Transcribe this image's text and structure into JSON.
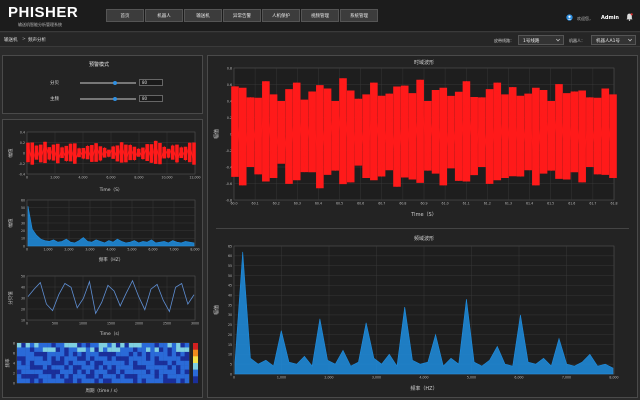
{
  "app": {
    "logo": "PHISHER",
    "subtitle": "输送机智能分析管理系统"
  },
  "nav": [
    "首页",
    "机器人",
    "输送机",
    "异常告警",
    "人机保护",
    "视频管理",
    "系统管理"
  ],
  "user": {
    "label": "欢迎您，",
    "name": "Admin"
  },
  "breadcrumb": {
    "root": "输送机",
    "current": "频声分析"
  },
  "selectors": {
    "line_label": "皮带线路：",
    "line_value": "1号线路",
    "robot_label": "机器人：",
    "robot_value": "机器人A1号"
  },
  "mode_panel": {
    "title": "预警模式",
    "sliders": [
      {
        "label": "分贝",
        "value": "80",
        "level": 0.62
      },
      {
        "label": "主频",
        "value": "80",
        "level": 0.62
      }
    ]
  },
  "colors": {
    "accent": "#2f8fe0",
    "time_wave": "#ff1a1a",
    "freq_wave": "#1f8ee0",
    "panel_bg": "#232323"
  },
  "chart_data": [
    {
      "type": "line",
      "ylabel": "幅值",
      "xlabel": "Time（S）",
      "x_tick_labels": [
        "0",
        "2,000",
        "4,000",
        "6,000",
        "8,000",
        "10,000",
        "12,000"
      ],
      "y_tick_labels": [
        "0.4",
        "0.2",
        "0",
        "-0.2",
        "-0.4"
      ],
      "series": [
        {
          "color": "#ff1a1a",
          "values": [
            0.22,
            -0.25,
            0.16,
            -0.2,
            0.24,
            -0.14,
            0.18,
            -0.22,
            0.12,
            -0.17,
            0.2,
            -0.23,
            0.1,
            -0.12,
            0.15,
            -0.19,
            0.21,
            -0.16,
            0.11,
            -0.08,
            0.14,
            -0.18,
            0.23,
            -0.2,
            0.17,
            -0.15,
            0.09,
            -0.13,
            0.19,
            -0.21,
            0.26,
            -0.24,
            0.13,
            -0.1,
            0.16,
            -0.2,
            0.12,
            -0.15,
            0.22,
            -0.25
          ]
        }
      ]
    },
    {
      "type": "area",
      "ylabel": "幅值",
      "xlabel": "频率（HZ）",
      "x_tick_labels": [
        "0",
        "1,000",
        "2,000",
        "3,000",
        "4,000",
        "5,000",
        "6,000",
        "7,000",
        "8,000"
      ],
      "y_tick_labels": [
        "60",
        "50",
        "40",
        "30",
        "20",
        "10",
        "0"
      ],
      "series": [
        {
          "color": "#1f8ee0",
          "values": [
            52,
            22,
            14,
            9,
            7,
            6,
            8,
            5,
            6,
            9,
            5,
            4,
            7,
            11,
            6,
            5,
            8,
            6,
            4,
            7,
            5,
            9,
            6,
            4,
            5,
            7,
            4,
            6,
            5,
            8,
            4,
            5,
            6,
            4,
            7,
            5,
            4,
            6,
            5,
            4
          ]
        }
      ]
    },
    {
      "type": "line",
      "ylabel": "分贝值",
      "xlabel": "Time（s）",
      "x_tick_labels": [
        "0",
        "500",
        "1000",
        "1500",
        "2000",
        "2500",
        "3000"
      ],
      "y_tick_labels": [
        "50",
        "40",
        "30",
        "20",
        "10"
      ],
      "series": [
        {
          "color": "#5f8fd4",
          "values": [
            30,
            38,
            45,
            22,
            15,
            32,
            44,
            40,
            18,
            28,
            46,
            12,
            24,
            42,
            36,
            20,
            34,
            47,
            30,
            16,
            38,
            43,
            26,
            14,
            40,
            44,
            22,
            32
          ]
        }
      ]
    },
    {
      "type": "heatmap",
      "xlabel": "周期（time / s）",
      "ylabel": "频率",
      "y_tick_labels": [
        "8",
        "6",
        "4",
        "2",
        "0"
      ],
      "colorbar": [
        "#d42020",
        "#f08a1c",
        "#f5e24a",
        "#7fd0e0",
        "#2a6ad8",
        "#1a2f9a"
      ]
    },
    {
      "type": "line",
      "title": "时域波形",
      "ylabel": "幅值",
      "xlabel": "Time（S）",
      "x_tick_labels": [
        "60.0",
        "60.1",
        "60.2",
        "60.3",
        "60.4",
        "60.5",
        "60.6",
        "60.7",
        "60.8",
        "60.9",
        "61.0",
        "61.1",
        "61.2",
        "61.3",
        "61.4",
        "61.5",
        "61.6",
        "61.7",
        "61.8"
      ],
      "y_tick_labels": [
        "0.8",
        "0.6",
        "0.4",
        "0.2",
        "0",
        "-0.2",
        "-0.4",
        "-0.6",
        "-0.8"
      ],
      "series": [
        {
          "color": "#ff1a1a",
          "values": [
            0.65,
            -0.7,
            0.5,
            -0.55,
            0.72,
            -0.6,
            0.45,
            -0.68,
            0.7,
            -0.52,
            0.58,
            -0.74,
            0.62,
            -0.5,
            0.76,
            -0.66,
            0.48,
            -0.6,
            0.7,
            -0.58,
            0.55,
            -0.72,
            0.66,
            -0.62,
            0.74,
            -0.5,
            0.6,
            -0.7,
            0.52,
            -0.64,
            0.72,
            -0.56,
            0.5,
            -0.68,
            0.7,
            -0.6,
            0.64,
            -0.58,
            0.55,
            -0.7,
            0.6,
            -0.5,
            0.68,
            -0.62,
            0.58,
            -0.66,
            0.5,
            -0.55,
            0.62,
            -0.6
          ]
        }
      ]
    },
    {
      "type": "area",
      "title": "频域波形",
      "ylabel": "幅值",
      "xlabel": "频率（HZ）",
      "x_tick_labels": [
        "0",
        "1,000",
        "2,000",
        "3,000",
        "4,000",
        "5,000",
        "6,000",
        "7,000",
        "8,000"
      ],
      "y_tick_labels": [
        "65",
        "60",
        "55",
        "50",
        "45",
        "40",
        "35",
        "30",
        "25",
        "20",
        "15",
        "10",
        "5",
        "0"
      ],
      "series": [
        {
          "color": "#1f8ee0",
          "values": [
            6,
            62,
            8,
            5,
            7,
            4,
            22,
            6,
            5,
            9,
            4,
            28,
            7,
            5,
            12,
            4,
            6,
            26,
            8,
            5,
            10,
            4,
            34,
            7,
            5,
            6,
            20,
            4,
            8,
            5,
            38,
            6,
            4,
            7,
            14,
            5,
            4,
            30,
            6,
            5,
            8,
            4,
            18,
            5,
            4,
            6,
            10,
            4,
            5,
            3
          ]
        }
      ]
    }
  ]
}
